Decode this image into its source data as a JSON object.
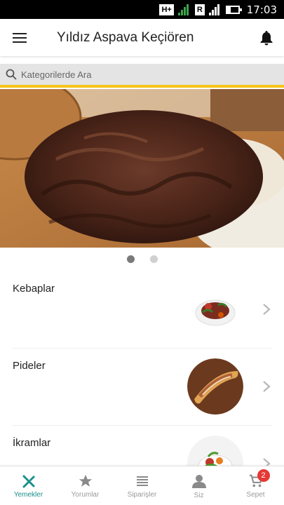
{
  "status_bar": {
    "net1": "H+",
    "sig1": "1",
    "net2": "R",
    "sig2": "2",
    "time": "17:03"
  },
  "header": {
    "title": "Yıldız Aspava Keçiören"
  },
  "search": {
    "placeholder": "Kategorilerde Ara"
  },
  "banner": {
    "slides": 2,
    "active_slide": 1
  },
  "categories": [
    {
      "label": "Kebaplar"
    },
    {
      "label": "Pideler"
    },
    {
      "label": "İkramlar"
    }
  ],
  "bottom_nav": [
    {
      "label": "Yemekler",
      "icon": "fork-knife-icon",
      "active": true
    },
    {
      "label": "Yorumlar",
      "icon": "star-icon"
    },
    {
      "label": "Siparişler",
      "icon": "list-icon"
    },
    {
      "label": "Siz",
      "icon": "person-icon"
    },
    {
      "label": "Sepet",
      "icon": "cart-icon",
      "badge": "2"
    }
  ],
  "colors": {
    "accent": "#1a8f8a",
    "search_stripe": "#f5c518",
    "badge": "#e53935"
  }
}
